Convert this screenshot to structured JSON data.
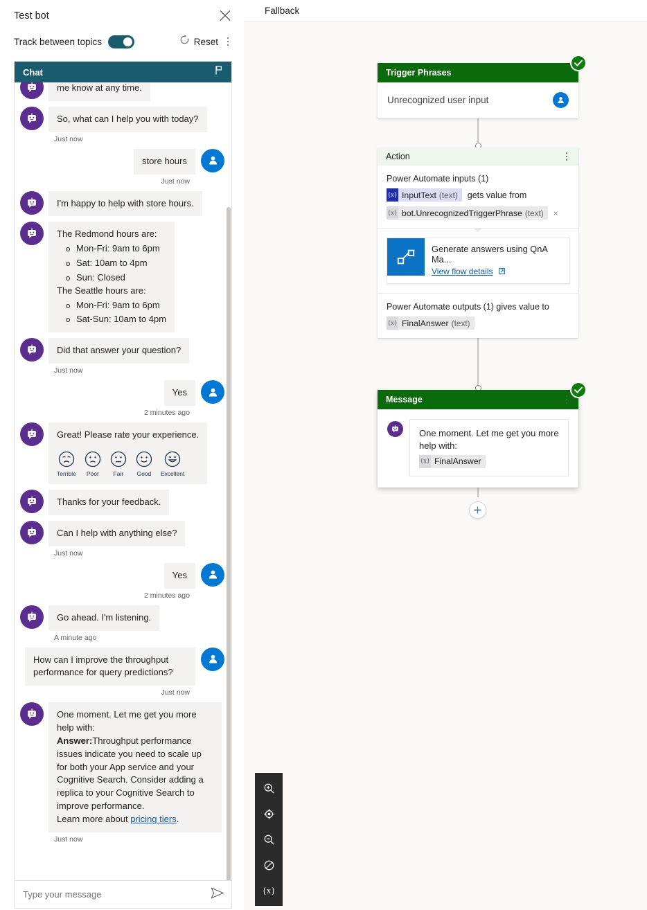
{
  "test_bot": {
    "title": "Test bot",
    "close_label": "×",
    "track_toggle_label": "Track between topics",
    "track_toggle_on": true,
    "reset_label": "Reset",
    "chat_header": "Chat",
    "input_placeholder": "Type your message",
    "messages": [
      {
        "sender": "bot",
        "text": "me know at any time.",
        "timestamp": "",
        "partial": true
      },
      {
        "sender": "bot",
        "text": "So, what can I help you with today?",
        "timestamp": "Just now"
      },
      {
        "sender": "user",
        "text": "store hours",
        "timestamp": "Just now"
      },
      {
        "sender": "bot",
        "text": "I'm happy to help with store hours.",
        "timestamp": ""
      },
      {
        "sender": "bot",
        "type": "hours",
        "timestamp": "",
        "redmond_label": "The Redmond hours are:",
        "redmond": [
          "Mon-Fri: 9am to 6pm",
          "Sat: 10am to 4pm",
          "Sun: Closed"
        ],
        "seattle_label": "The Seattle hours are:",
        "seattle": [
          "Mon-Fri: 9am to 6pm",
          "Sat-Sun: 10am to 4pm"
        ]
      },
      {
        "sender": "bot",
        "text": "Did that answer your question?",
        "timestamp": "Just now"
      },
      {
        "sender": "user",
        "text": "Yes",
        "timestamp": "2 minutes ago"
      },
      {
        "sender": "bot",
        "type": "rating",
        "text": "Great! Please rate your experience.",
        "timestamp": ""
      },
      {
        "sender": "bot",
        "text": "Thanks for your feedback.",
        "timestamp": ""
      },
      {
        "sender": "bot",
        "text": "Can I help with anything else?",
        "timestamp": "Just now"
      },
      {
        "sender": "user",
        "text": "Yes",
        "timestamp": "2 minutes ago"
      },
      {
        "sender": "bot",
        "text": "Go ahead. I'm listening.",
        "timestamp": "A minute ago"
      },
      {
        "sender": "user",
        "text": "How can I improve the throughput performance for query predictions?",
        "timestamp": "Just now"
      },
      {
        "sender": "bot",
        "type": "answer",
        "timestamp": "Just now",
        "intro": "One moment. Let me get you more help with:",
        "answer_label": "Answer:",
        "answer_body": "Throughput performance issues indicate you need to scale up for both your App service and your Cognitive Search. Consider adding a replica to your Cognitive Search to improve performance.",
        "learn_prefix": "Learn more about ",
        "learn_link": "pricing tiers",
        "learn_suffix": "."
      }
    ],
    "rating_faces": [
      {
        "label": "Terrible",
        "mood": "terrible"
      },
      {
        "label": "Poor",
        "mood": "poor"
      },
      {
        "label": "Fair",
        "mood": "fair"
      },
      {
        "label": "Good",
        "mood": "good"
      },
      {
        "label": "Excellent",
        "mood": "excellent"
      }
    ]
  },
  "canvas": {
    "topic_title": "Fallback",
    "nodes": {
      "trigger": {
        "header": "Trigger Phrases",
        "phrase": "Unrecognized user input",
        "status": "complete"
      },
      "action": {
        "header": "Action",
        "inputs_label": "Power Automate inputs (1)",
        "input_token_name": "InputText",
        "input_token_type": "(text)",
        "gets_value_from": "gets value from",
        "source_token_name": "bot.UnrecognizedTriggerPhrase",
        "source_token_type": "(text)",
        "remove_label": "×",
        "flow_name": "Generate answers using QnA Ma...",
        "flow_link": "View flow details",
        "outputs_label": "Power Automate outputs (1) gives value to",
        "output_token_name": "FinalAnswer",
        "output_token_type": "(text)"
      },
      "message": {
        "header": "Message",
        "line1": "One moment. Let me get you more",
        "line2": "help with:",
        "variable": "FinalAnswer",
        "status": "complete"
      }
    },
    "add_node_label": "+",
    "toolbar": [
      {
        "name": "zoom-in-icon",
        "label": ""
      },
      {
        "name": "fit-to-screen-icon",
        "label": ""
      },
      {
        "name": "zoom-out-icon",
        "label": ""
      },
      {
        "name": "reset-zoom-icon",
        "label": ""
      },
      {
        "name": "variables-icon",
        "label": "{x}"
      }
    ]
  },
  "colors": {
    "teal": "#1a5b6e",
    "green_header": "#0b6a0b",
    "action_header": "#eef6ee",
    "bot_purple": "#5b2d8e",
    "user_blue": "#0078d4",
    "link_blue": "#0f5ca8",
    "flow_blue": "#0b72c4"
  }
}
